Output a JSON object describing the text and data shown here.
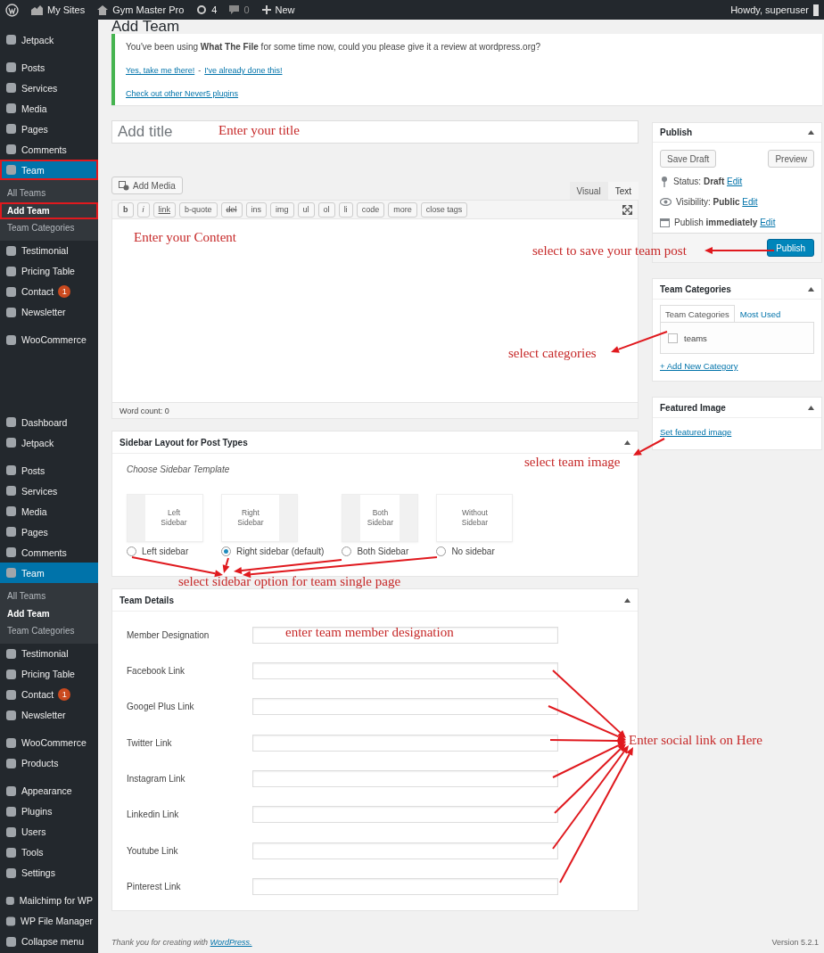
{
  "admin_bar": {
    "my_sites": "My Sites",
    "site_name": "Gym Master Pro",
    "updates": "4",
    "comments": "0",
    "new": "New",
    "greeting": "Howdy, superuser"
  },
  "sidebar": {
    "sections": [
      {
        "groups": [
          [
            {
              "label": "Jetpack",
              "selected": false,
              "outlined": false
            }
          ],
          [
            {
              "label": "Posts",
              "selected": false,
              "outlined": false
            },
            {
              "label": "Services",
              "selected": false,
              "outlined": false
            },
            {
              "label": "Media",
              "selected": false,
              "outlined": false
            },
            {
              "label": "Pages",
              "selected": false,
              "outlined": false
            },
            {
              "label": "Comments",
              "selected": false,
              "outlined": false
            },
            {
              "label": "Team",
              "selected": true,
              "outlined": true,
              "children": [
                {
                  "label": "All Teams",
                  "selected": false,
                  "outlined": false
                },
                {
                  "label": "Add Team",
                  "selected": true,
                  "outlined": true
                },
                {
                  "label": "Team Categories",
                  "selected": false,
                  "outlined": false
                }
              ]
            },
            {
              "label": "Testimonial",
              "selected": false,
              "outlined": false
            },
            {
              "label": "Pricing Table",
              "selected": false,
              "outlined": false
            },
            {
              "label": "Contact",
              "selected": false,
              "outlined": false,
              "badge": "1"
            },
            {
              "label": "Newsletter",
              "selected": false,
              "outlined": false
            }
          ],
          [
            {
              "label": "WooCommerce",
              "selected": false,
              "outlined": false
            }
          ]
        ]
      },
      {
        "groups": [
          [
            {
              "label": "Dashboard",
              "selected": false,
              "outlined": false
            },
            {
              "label": "Jetpack",
              "selected": false,
              "outlined": false
            }
          ],
          [
            {
              "label": "Posts",
              "selected": false,
              "outlined": false
            },
            {
              "label": "Services",
              "selected": false,
              "outlined": false
            },
            {
              "label": "Media",
              "selected": false,
              "outlined": false
            },
            {
              "label": "Pages",
              "selected": false,
              "outlined": false
            },
            {
              "label": "Comments",
              "selected": false,
              "outlined": false
            },
            {
              "label": "Team",
              "selected": true,
              "outlined": false,
              "children": [
                {
                  "label": "All Teams",
                  "selected": false,
                  "outlined": false
                },
                {
                  "label": "Add Team",
                  "selected": true,
                  "outlined": false
                },
                {
                  "label": "Team Categories",
                  "selected": false,
                  "outlined": false
                }
              ]
            },
            {
              "label": "Testimonial",
              "selected": false,
              "outlined": false
            },
            {
              "label": "Pricing Table",
              "selected": false,
              "outlined": false
            },
            {
              "label": "Contact",
              "selected": false,
              "outlined": false,
              "badge": "1"
            },
            {
              "label": "Newsletter",
              "selected": false,
              "outlined": false
            }
          ],
          [
            {
              "label": "WooCommerce",
              "selected": false,
              "outlined": false
            },
            {
              "label": "Products",
              "selected": false,
              "outlined": false
            }
          ],
          [
            {
              "label": "Appearance",
              "selected": false,
              "outlined": false
            },
            {
              "label": "Plugins",
              "selected": false,
              "outlined": false
            },
            {
              "label": "Users",
              "selected": false,
              "outlined": false
            },
            {
              "label": "Tools",
              "selected": false,
              "outlined": false
            },
            {
              "label": "Settings",
              "selected": false,
              "outlined": false
            }
          ],
          [
            {
              "label": "Mailchimp for WP",
              "selected": false,
              "outlined": false
            },
            {
              "label": "WP File Manager",
              "selected": false,
              "outlined": false
            },
            {
              "label": "Collapse menu",
              "selected": false,
              "outlined": false
            }
          ]
        ]
      }
    ]
  },
  "page_title": "Add Team",
  "notice": {
    "message": "You've been using **What The File** for some time now, could you please give it a review at wordpress.org?",
    "links": [
      "Yes, take me there!",
      "I've already done this!"
    ],
    "separator": "-",
    "footer_link": "Check out other Never5 plugins"
  },
  "editor": {
    "title_placeholder": "Add title",
    "add_media": "Add Media",
    "tabs": [
      {
        "label": "Visual",
        "selected": false
      },
      {
        "label": "Text",
        "selected": true
      }
    ],
    "quicktags": [
      {
        "label": "b",
        "kind": "bold"
      },
      {
        "label": "i",
        "kind": "italic"
      },
      {
        "label": "link",
        "kind": "underline"
      },
      {
        "label": "b-quote",
        "kind": "plain"
      },
      {
        "label": "del",
        "kind": "strike"
      },
      {
        "label": "ins",
        "kind": "plain"
      },
      {
        "label": "img",
        "kind": "plain"
      },
      {
        "label": "ul",
        "kind": "plain"
      },
      {
        "label": "ol",
        "kind": "plain"
      },
      {
        "label": "li",
        "kind": "plain"
      },
      {
        "label": "code",
        "kind": "plain"
      },
      {
        "label": "more",
        "kind": "plain"
      },
      {
        "label": "close tags",
        "kind": "plain"
      }
    ],
    "word_count": "Word count: 0"
  },
  "sidebar_layout": {
    "title": "Sidebar Layout for Post Types",
    "subtitle": "Choose Sidebar Template",
    "options": [
      {
        "kind": "left",
        "thumb_lines": [
          "Left",
          "Sidebar"
        ],
        "label": "Left sidebar",
        "selected": false
      },
      {
        "kind": "right",
        "thumb_lines": [
          "Right",
          "Sidebar"
        ],
        "label": "Right sidebar (default)",
        "selected": true
      },
      {
        "kind": "both",
        "thumb_lines": [
          "Both",
          "Sidebar"
        ],
        "label": "Both Sidebar",
        "selected": false
      },
      {
        "kind": "none",
        "thumb_lines": [
          "Without",
          "Sidebar"
        ],
        "label": "No sidebar",
        "selected": false
      }
    ]
  },
  "team_details": {
    "title": "Team Details",
    "fields": [
      {
        "label": "Member Designation"
      },
      {
        "label": "Facebook Link"
      },
      {
        "label": "Googel Plus Link"
      },
      {
        "label": "Twitter Link"
      },
      {
        "label": "Instagram Link"
      },
      {
        "label": "Linkedin Link"
      },
      {
        "label": "Youtube Link"
      },
      {
        "label": "Pinterest Link"
      }
    ]
  },
  "publish": {
    "title": "Publish",
    "save_draft": "Save Draft",
    "preview": "Preview",
    "meta": [
      {
        "kind": "status",
        "label": "Status:",
        "value": "Draft",
        "link": "Edit"
      },
      {
        "kind": "visibility",
        "label": "Visibility:",
        "value": "Public",
        "link": "Edit"
      },
      {
        "kind": "schedule",
        "label": "Publish",
        "value": "immediately",
        "link": "Edit"
      }
    ],
    "button": "Publish"
  },
  "categories": {
    "title": "Team Categories",
    "tabs": [
      {
        "label": "Team Categories",
        "selected": true
      },
      {
        "label": "Most Used",
        "selected": false
      }
    ],
    "items": [
      {
        "label": "teams",
        "checked": false
      }
    ],
    "add_link": "+ Add New Category"
  },
  "featured_image": {
    "title": "Featured Image",
    "link": "Set featured image"
  },
  "footer": {
    "thanks": "Thank you for creating with",
    "link": "WordPress.",
    "version": "Version 5.2.1"
  },
  "annotations": [
    "Enter your title",
    "Enter your Content",
    "select to save your team post",
    "select categories",
    "select team image",
    "select sidebar option for team single page",
    "enter team member designation",
    "Enter social link on Here"
  ]
}
